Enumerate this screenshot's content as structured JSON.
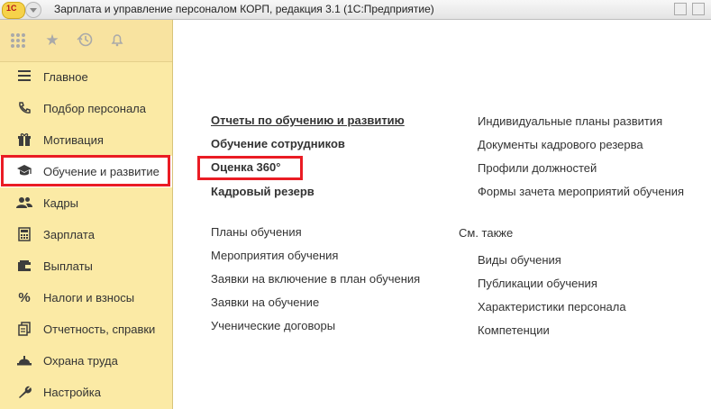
{
  "titlebar": {
    "logo": "1С",
    "title": "Зарплата и управление персоналом КОРП, редакция 3.1  (1С:Предприятие)"
  },
  "sidebar": {
    "items": [
      {
        "label": "Главное",
        "icon": "hamburger-icon"
      },
      {
        "label": "Подбор персонала",
        "icon": "phone-icon"
      },
      {
        "label": "Мотивация",
        "icon": "gift-icon"
      },
      {
        "label": "Обучение и развитие",
        "icon": "graduation-cap-icon"
      },
      {
        "label": "Кадры",
        "icon": "people-icon"
      },
      {
        "label": "Зарплата",
        "icon": "calculator-icon"
      },
      {
        "label": "Выплаты",
        "icon": "wallet-icon"
      },
      {
        "label": "Налоги и взносы",
        "icon": "percent-icon"
      },
      {
        "label": "Отчетность, справки",
        "icon": "documents-icon"
      },
      {
        "label": "Охрана труда",
        "icon": "hardhat-icon"
      },
      {
        "label": "Настройка",
        "icon": "wrench-icon"
      }
    ]
  },
  "content": {
    "left_bold": [
      "Отчеты по обучению и развитию",
      "Обучение сотрудников",
      "Оценка 360°",
      "Кадровый резерв"
    ],
    "left_plain": [
      "Планы обучения",
      "Мероприятия обучения",
      "Заявки на включение в план обучения",
      "Заявки на обучение",
      "Ученические договоры"
    ],
    "right_top": [
      "Индивидуальные планы развития",
      "Документы кадрового резерва",
      "Профили должностей",
      "Формы зачета мероприятий обучения"
    ],
    "see_also_header": "См. также",
    "see_also": [
      "Виды обучения",
      "Публикации обучения",
      "Характеристики персонала",
      "Компетенции"
    ]
  },
  "colors": {
    "sidebar_bg": "#fbeaa5",
    "highlight": "#ea1c24"
  }
}
